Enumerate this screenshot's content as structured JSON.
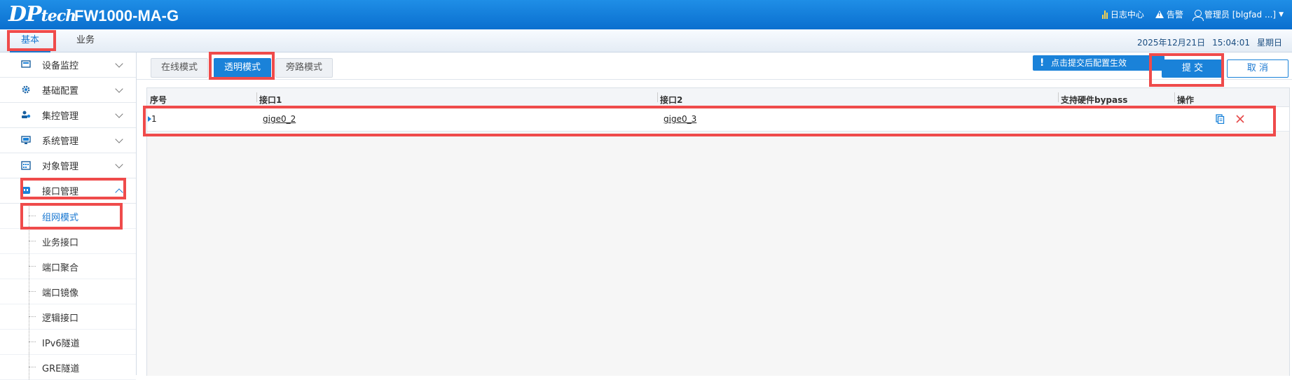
{
  "header": {
    "logo_main": "DP",
    "logo_tail": "tech",
    "product": "FW1000-MA-G",
    "log_center": "日志中心",
    "alarm": "告警",
    "user": "管理员 [blgfad ...]"
  },
  "nav": {
    "tabs": [
      {
        "label": "基本"
      },
      {
        "label": "业务"
      }
    ],
    "date": "2025年12月21日",
    "time": "15:04:01",
    "weekday": "星期日"
  },
  "sidebar": {
    "items": [
      {
        "label": "设备监控",
        "icon": "monitor-icon"
      },
      {
        "label": "基础配置",
        "icon": "gear-icon"
      },
      {
        "label": "集控管理",
        "icon": "cluster-icon"
      },
      {
        "label": "系统管理",
        "icon": "computer-icon"
      },
      {
        "label": "对象管理",
        "icon": "calendar-grid-icon"
      },
      {
        "label": "接口管理",
        "icon": "interface-icon"
      }
    ],
    "sub_items": [
      {
        "label": "组网模式"
      },
      {
        "label": "业务接口"
      },
      {
        "label": "端口聚合"
      },
      {
        "label": "端口镜像"
      },
      {
        "label": "逻辑接口"
      },
      {
        "label": "IPv6隧道"
      },
      {
        "label": "GRE隧道"
      }
    ]
  },
  "main": {
    "mode_tabs": [
      {
        "label": "在线模式"
      },
      {
        "label": "透明模式"
      },
      {
        "label": "旁路模式"
      }
    ],
    "active_mode": "透明模式",
    "notice": "点击提交后配置生效",
    "submit": "提 交",
    "cancel": "取 消",
    "table": {
      "headers": [
        "序号",
        "接口1",
        "接口2",
        "支持硬件bypass",
        "操作"
      ],
      "rows": [
        {
          "index": "1",
          "iface1": "gige0_2",
          "iface2": "gige0_3",
          "bypass": ""
        }
      ]
    }
  },
  "colors": {
    "accent": "#1a82d9",
    "highlight": "#ef4b4b",
    "topbar": "#0a6fcf"
  }
}
